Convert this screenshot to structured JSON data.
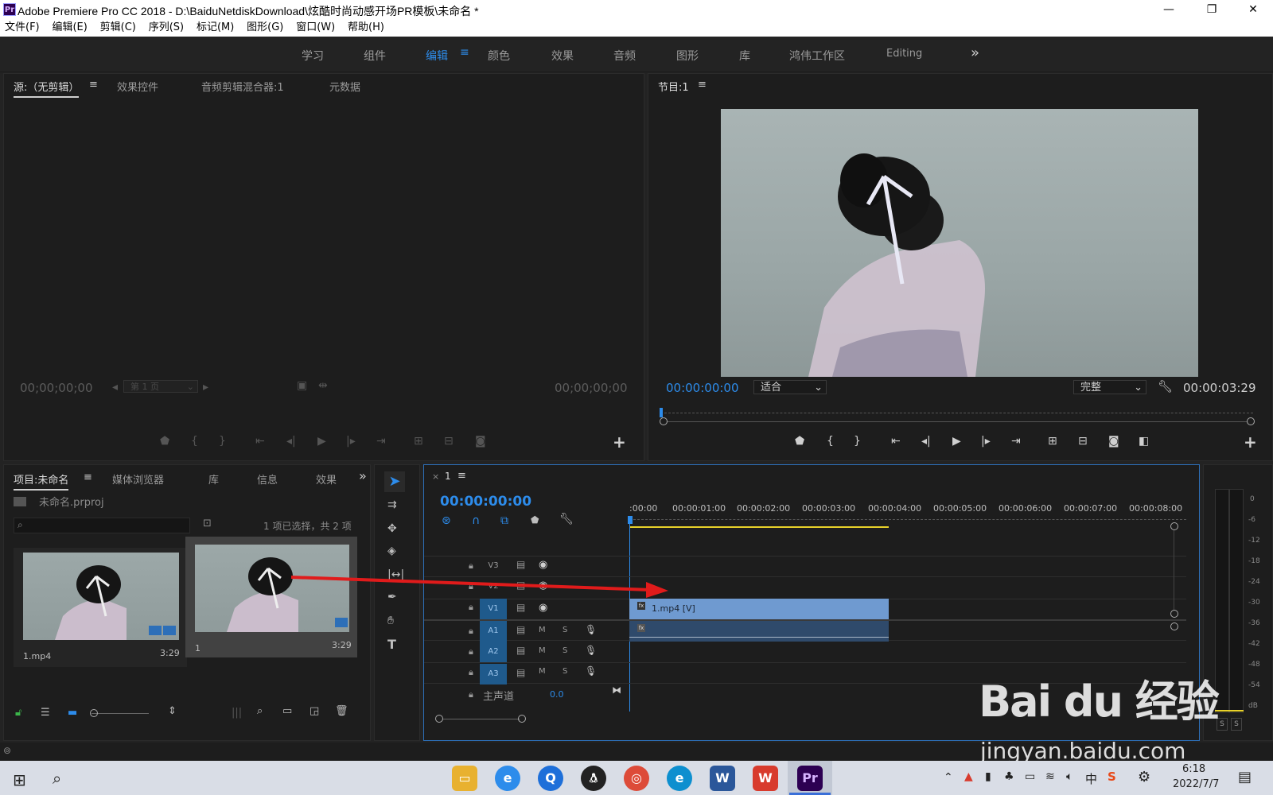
{
  "window": {
    "app_icon": "Pr",
    "title": "Adobe Premiere Pro CC 2018 - D:\\BaiduNetdiskDownload\\炫酷时尚动感开场PR模板\\未命名 *",
    "minimize_icon": "—",
    "restore_icon": "❐",
    "close_icon": "✕"
  },
  "menu": [
    "文件(F)",
    "编辑(E)",
    "剪辑(C)",
    "序列(S)",
    "标记(M)",
    "图形(G)",
    "窗口(W)",
    "帮助(H)"
  ],
  "workspaces": {
    "items": [
      "学习",
      "组件",
      "编辑",
      "颜色",
      "效果",
      "音频",
      "图形",
      "库",
      "鸿伟工作区",
      "Editing"
    ],
    "active": "编辑",
    "overflow_icon": "»"
  },
  "source_panel": {
    "tabs": [
      "源:（无剪辑）",
      "效果控件",
      "音频剪辑混合器:1",
      "元数据"
    ],
    "timecode_left": "00;00;00;00",
    "timecode_right": "00;00;00;00",
    "page_label": "第 1 页"
  },
  "program_panel": {
    "tab": "节目:1",
    "timecode_current": "00:00:00:00",
    "zoom": "适合",
    "quality": "完整",
    "duration": "00:00:03:29"
  },
  "project_panel": {
    "tabs": [
      "项目:未命名",
      "媒体浏览器",
      "库",
      "信息",
      "效果"
    ],
    "project_file": "未命名.prproj",
    "selection_info": "1 项已选择，共 2 项",
    "items": [
      {
        "name": "1.mp4",
        "duration": "3:29"
      },
      {
        "name": "1",
        "duration": "3:29"
      }
    ]
  },
  "timeline": {
    "sequence_name": "1",
    "timecode": "00:00:00:00",
    "ruler": [
      ":00:00",
      "00:00:01:00",
      "00:00:02:00",
      "00:00:03:00",
      "00:00:04:00",
      "00:00:05:00",
      "00:00:06:00",
      "00:00:07:00",
      "00:00:08:00"
    ],
    "video_tracks": [
      "V3",
      "V2",
      "V1"
    ],
    "audio_tracks": [
      "A1",
      "A2",
      "A3"
    ],
    "mute_label": "M",
    "solo_label": "S",
    "master_label": "主声道",
    "master_value": "0.0",
    "clip_label": "1.mp4 [V]",
    "fx_label": "fx"
  },
  "meters": {
    "scale": [
      "0",
      "-6",
      "-12",
      "-18",
      "-24",
      "-30",
      "-36",
      "-42",
      "-48",
      "-54",
      "dB"
    ],
    "solo_buttons": [
      "S",
      "S"
    ]
  },
  "watermark": {
    "logo": "Bai du 经验",
    "url": "jingyan.baidu.com"
  },
  "taskbar": {
    "time": "6:18",
    "date": "2022/7/7",
    "ime": "中"
  },
  "colors": {
    "accent": "#2d8ceb",
    "clip_video": "#6f9ad0",
    "clip_audio": "#2f4a6b",
    "arrow": "#e01b1b",
    "playhead_range": "#e8d22a"
  }
}
